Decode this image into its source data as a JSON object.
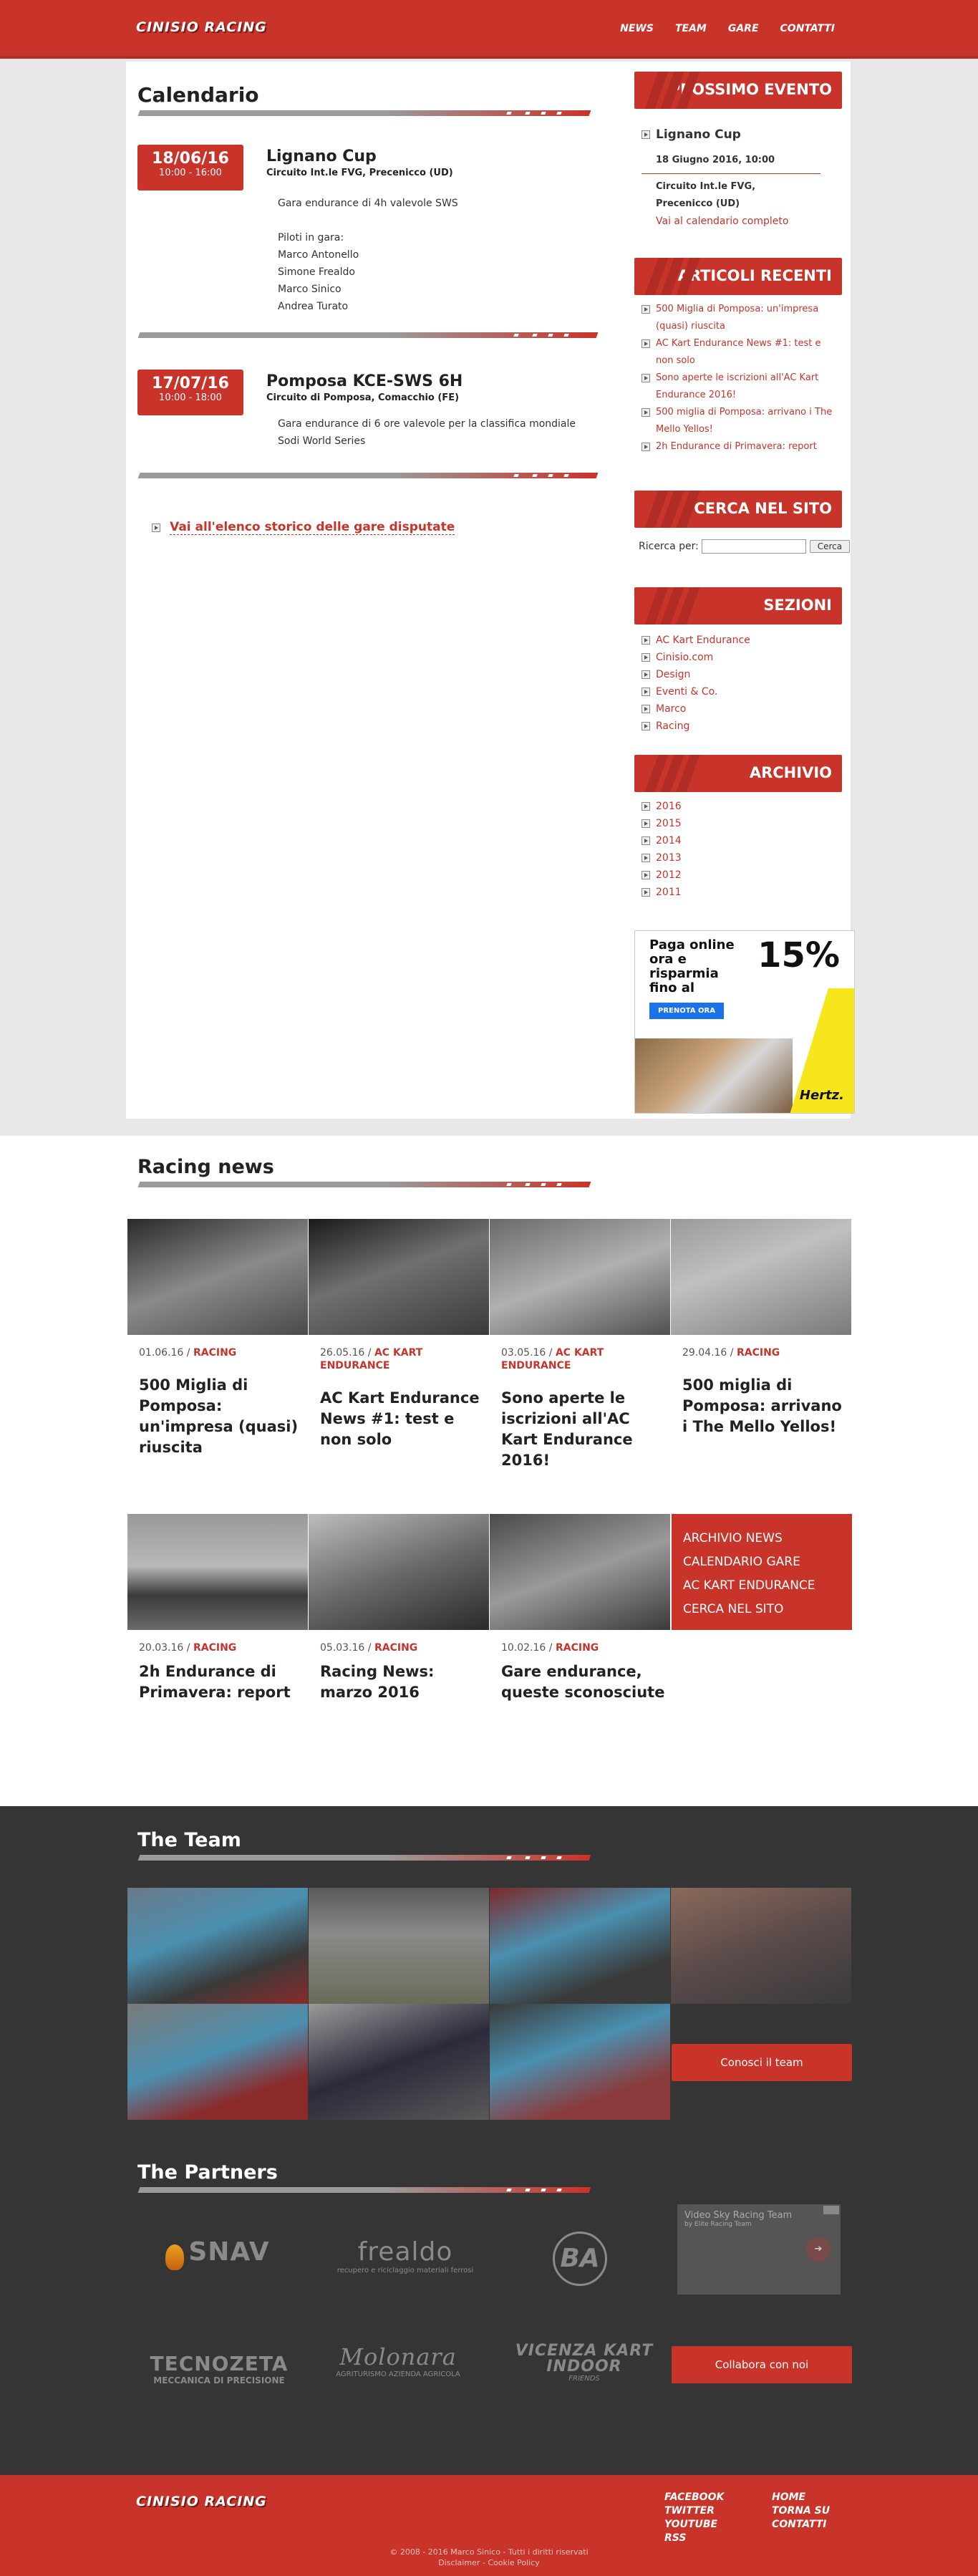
{
  "header": {
    "logo": "CINISIO RACING",
    "nav": [
      "NEWS",
      "TEAM",
      "GARE",
      "CONTATTI"
    ]
  },
  "calendar": {
    "title": "Calendario",
    "events": [
      {
        "date": "18/06/16",
        "time": "10:00 - 16:00",
        "title": "Lignano Cup",
        "place": "Circuito Int.le FVG, Precenicco (UD)",
        "description": "Gara endurance di 4h valevole SWS",
        "pilots_label": "Piloti in gara:",
        "pilots": [
          "Marco Antonello",
          "Simone Frealdo",
          "Marco Sinico",
          "Andrea Turato"
        ]
      },
      {
        "date": "17/07/16",
        "time": "10:00 - 18:00",
        "title": "Pomposa KCE-SWS 6H",
        "place": "Circuito di Pomposa, Comacchio (FE)",
        "description": "Gara endurance di 6 ore valevole per la classifica mondiale Sodi World Series"
      }
    ],
    "history_link": "Vai all'elenco storico delle gare disputate"
  },
  "sidebar": {
    "next_event": {
      "heading": "PROSSIMO EVENTO",
      "title": "Lignano Cup",
      "datetime": "18 Giugno 2016, 10:00",
      "place_line1": "Circuito Int.le FVG,",
      "place_line2": "Precenicco (UD)",
      "link": "Vai al calendario completo"
    },
    "recent": {
      "heading": "ARTICOLI RECENTI",
      "items": [
        "500 Miglia di Pomposa: un'impresa (quasi) riuscita",
        "AC Kart Endurance News #1: test e non solo",
        "Sono aperte le iscrizioni all'AC Kart Endurance 2016!",
        "500 miglia di Pomposa: arrivano i The Mello Yellos!",
        "2h Endurance di Primavera: report"
      ]
    },
    "search": {
      "heading": "CERCA NEL SITO",
      "label": "Ricerca per:",
      "button": "Cerca"
    },
    "sections": {
      "heading": "SEZIONI",
      "items": [
        "AC Kart Endurance",
        "Cinisio.com",
        "Design",
        "Eventi & Co.",
        "Marco",
        "Racing"
      ]
    },
    "archive": {
      "heading": "ARCHIVIO",
      "items": [
        "2016",
        "2015",
        "2014",
        "2013",
        "2012",
        "2011"
      ]
    },
    "ad": {
      "headline": "Paga online ora e risparmia fino al",
      "percent": "15%",
      "cta": "PRENOTA ORA",
      "brand": "Hertz."
    }
  },
  "news": {
    "title": "Racing news",
    "items": [
      {
        "date": "01.06.16",
        "category": "RACING",
        "title": "500 Miglia di Pomposa: un'impresa (quasi) riuscita"
      },
      {
        "date": "26.05.16",
        "category": "AC KART ENDURANCE",
        "title": "AC Kart Endurance News #1: test e non solo"
      },
      {
        "date": "03.05.16",
        "category": "AC KART ENDURANCE",
        "title": "Sono aperte le iscrizioni all'AC Kart Endurance 2016!"
      },
      {
        "date": "29.04.16",
        "category": "RACING",
        "title": "500 miglia di Pomposa: arrivano i The Mello Yellos!"
      },
      {
        "date": "20.03.16",
        "category": "RACING",
        "title": "2h Endurance di Primavera: report"
      },
      {
        "date": "05.03.16",
        "category": "RACING",
        "title": "Racing News: marzo 2016"
      },
      {
        "date": "10.02.16",
        "category": "RACING",
        "title": "Gare endurance, queste sconosciute"
      }
    ],
    "menu": [
      "ARCHIVIO NEWS",
      "CALENDARIO GARE",
      "AC KART ENDURANCE",
      "CERCA NEL SITO"
    ]
  },
  "team": {
    "title": "The Team",
    "button": "Conosci il team"
  },
  "partners": {
    "title": "The Partners",
    "logos": [
      {
        "name": "SNAV",
        "sub": ""
      },
      {
        "name": "frealdo",
        "sub": "recupero e riciclaggio materiali ferrosi"
      },
      {
        "name": "BA",
        "sub": ""
      },
      {
        "name": "TECNOZETA",
        "sub": "MECCANICA DI PRECISIONE"
      },
      {
        "name": "Molonara",
        "sub": "AGRITURISMO AZIENDA AGRICOLA"
      },
      {
        "name": "VICENZA KART INDOOR",
        "sub": "FRIENDS"
      }
    ],
    "video_ad": {
      "title": "Video Sky Racing Team",
      "sub": "by Elite Racing Team"
    },
    "button": "Collabora con noi"
  },
  "footer": {
    "logo": "CINISIO RACING",
    "links_col1": [
      "FACEBOOK",
      "TWITTER",
      "YOUTUBE",
      "RSS"
    ],
    "links_col2": [
      "HOME",
      "TORNA SU",
      "CONTATTI"
    ],
    "copyright": "© 2008 - 2016 Marco Sinico - Tutti i diritti riservati",
    "disclaimer": "Disclaimer - Cookie Policy"
  }
}
